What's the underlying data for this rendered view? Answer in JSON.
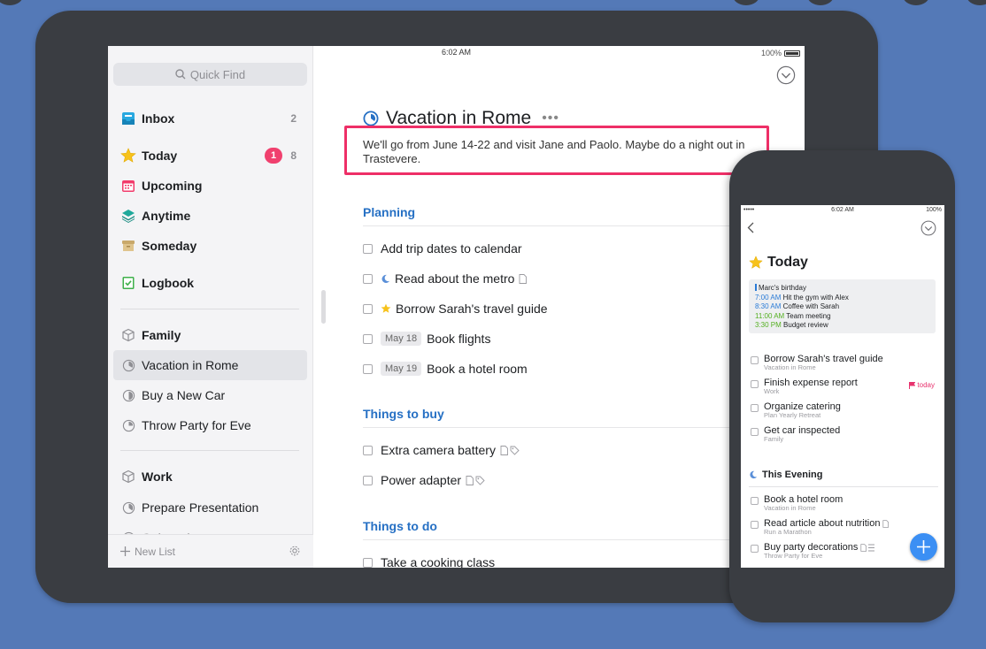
{
  "ipad": {
    "status": {
      "device": "iPad",
      "time": "6:02 AM",
      "battery": "100%"
    },
    "sidebar": {
      "quick_find_placeholder": "Quick Find",
      "items": [
        {
          "label": "Inbox",
          "count": "2",
          "icon": "inbox-icon"
        },
        {
          "label": "Today",
          "badge": "1",
          "count": "8",
          "icon": "star-icon"
        },
        {
          "label": "Upcoming",
          "icon": "calendar-icon"
        },
        {
          "label": "Anytime",
          "icon": "layers-icon"
        },
        {
          "label": "Someday",
          "icon": "archive-box-icon"
        },
        {
          "label": "Logbook",
          "icon": "logbook-check-icon"
        }
      ],
      "areas": [
        {
          "label": "Family",
          "projects": [
            "Vacation in Rome",
            "Buy a New Car",
            "Throw Party for Eve"
          ]
        },
        {
          "label": "Work",
          "projects": [
            "Prepare Presentation",
            "Onboard..."
          ]
        }
      ],
      "footer": {
        "new_list": "New List"
      }
    },
    "project": {
      "title": "Vacation in Rome",
      "more": "•••",
      "notes": "We'll go from June 14-22 and visit Jane and Paolo. Maybe do a night out in Trastevere.",
      "sections": [
        {
          "heading": "Planning",
          "todos": [
            {
              "title": "Add trip dates to calendar"
            },
            {
              "title": "Read about the metro",
              "pre": "moon-icon",
              "post": [
                "note-icon"
              ]
            },
            {
              "title": "Borrow Sarah's travel guide",
              "pre": "star-icon"
            },
            {
              "title": "Book flights",
              "date": "May 18"
            },
            {
              "title": "Book a hotel room",
              "date": "May 19"
            }
          ]
        },
        {
          "heading": "Things to buy",
          "todos": [
            {
              "title": "Extra camera battery",
              "post": [
                "note-icon",
                "tag-icon"
              ]
            },
            {
              "title": "Power adapter",
              "post": [
                "note-icon",
                "tag-icon"
              ]
            }
          ]
        },
        {
          "heading": "Things to do",
          "todos": [
            {
              "title": "Take a cooking class"
            }
          ]
        }
      ]
    }
  },
  "iphone": {
    "status": {
      "signal": "•••••",
      "time": "6:02 AM",
      "battery": "100%"
    },
    "title": "Today",
    "calendar": [
      {
        "time": "",
        "text": "Marc's birthday"
      },
      {
        "time": "7:00 AM",
        "text": "Hit the gym with Alex"
      },
      {
        "time": "8:30 AM",
        "text": "Coffee with Sarah"
      },
      {
        "time": "11:00 AM",
        "text": "Team meeting"
      },
      {
        "time": "3:30 PM",
        "text": "Budget review"
      }
    ],
    "todos": [
      {
        "title": "Borrow Sarah's travel guide",
        "sub": "Vacation in Rome"
      },
      {
        "title": "Finish expense report",
        "sub": "Work",
        "flag": "today"
      },
      {
        "title": "Organize catering",
        "sub": "Plan Yearly Retreat"
      },
      {
        "title": "Get car inspected",
        "sub": "Family"
      }
    ],
    "evening": {
      "heading": "This Evening",
      "todos": [
        {
          "title": "Book a hotel room",
          "sub": "Vacation in Rome"
        },
        {
          "title": "Read article about nutrition",
          "sub": "Run a Marathon"
        },
        {
          "title": "Buy party decorations",
          "sub": "Throw Party for Eve"
        }
      ]
    }
  },
  "colors": {
    "accent_blue": "#2670c4",
    "badge_pink": "#f0406e",
    "highlight_red": "#ee2f67",
    "fab_blue": "#3b8ff4"
  }
}
